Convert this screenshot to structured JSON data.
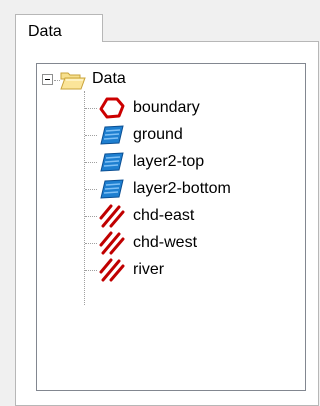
{
  "tab": {
    "label": "Data"
  },
  "tree": {
    "root": {
      "label": "Data",
      "icon": "folder-open-icon",
      "expanded": true
    },
    "items": [
      {
        "label": "boundary",
        "icon": "polygon-boundary-icon",
        "color": "#cc0000"
      },
      {
        "label": "ground",
        "icon": "surface-layer-icon",
        "color": "#1e7fd0"
      },
      {
        "label": "layer2-top",
        "icon": "surface-layer-icon",
        "color": "#1e7fd0"
      },
      {
        "label": "layer2-bottom",
        "icon": "surface-layer-icon",
        "color": "#1e7fd0"
      },
      {
        "label": "chd-east",
        "icon": "line-features-icon",
        "color": "#c00000"
      },
      {
        "label": "chd-west",
        "icon": "line-features-icon",
        "color": "#c00000"
      },
      {
        "label": "river",
        "icon": "line-features-icon",
        "color": "#c00000"
      }
    ]
  }
}
